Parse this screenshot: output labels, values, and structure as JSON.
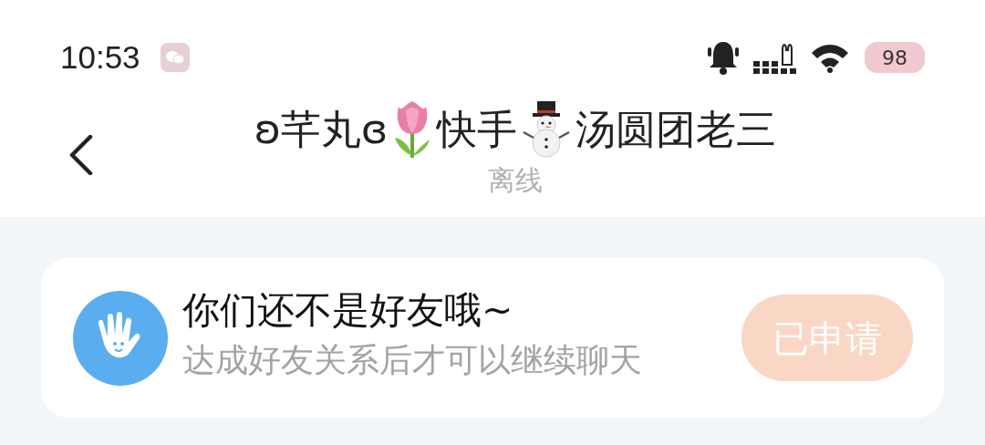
{
  "status_bar": {
    "time": "10:53",
    "battery": "98"
  },
  "header": {
    "title_segments": [
      "ʚ芊丸ɞ",
      "快手",
      "汤圆团老三"
    ],
    "subtitle": "离线"
  },
  "notice": {
    "title": "你们还不是好友哦~",
    "message": "达成好友关系后才可以继续聊天",
    "button": {
      "label": "已申请",
      "disabled": true
    }
  }
}
